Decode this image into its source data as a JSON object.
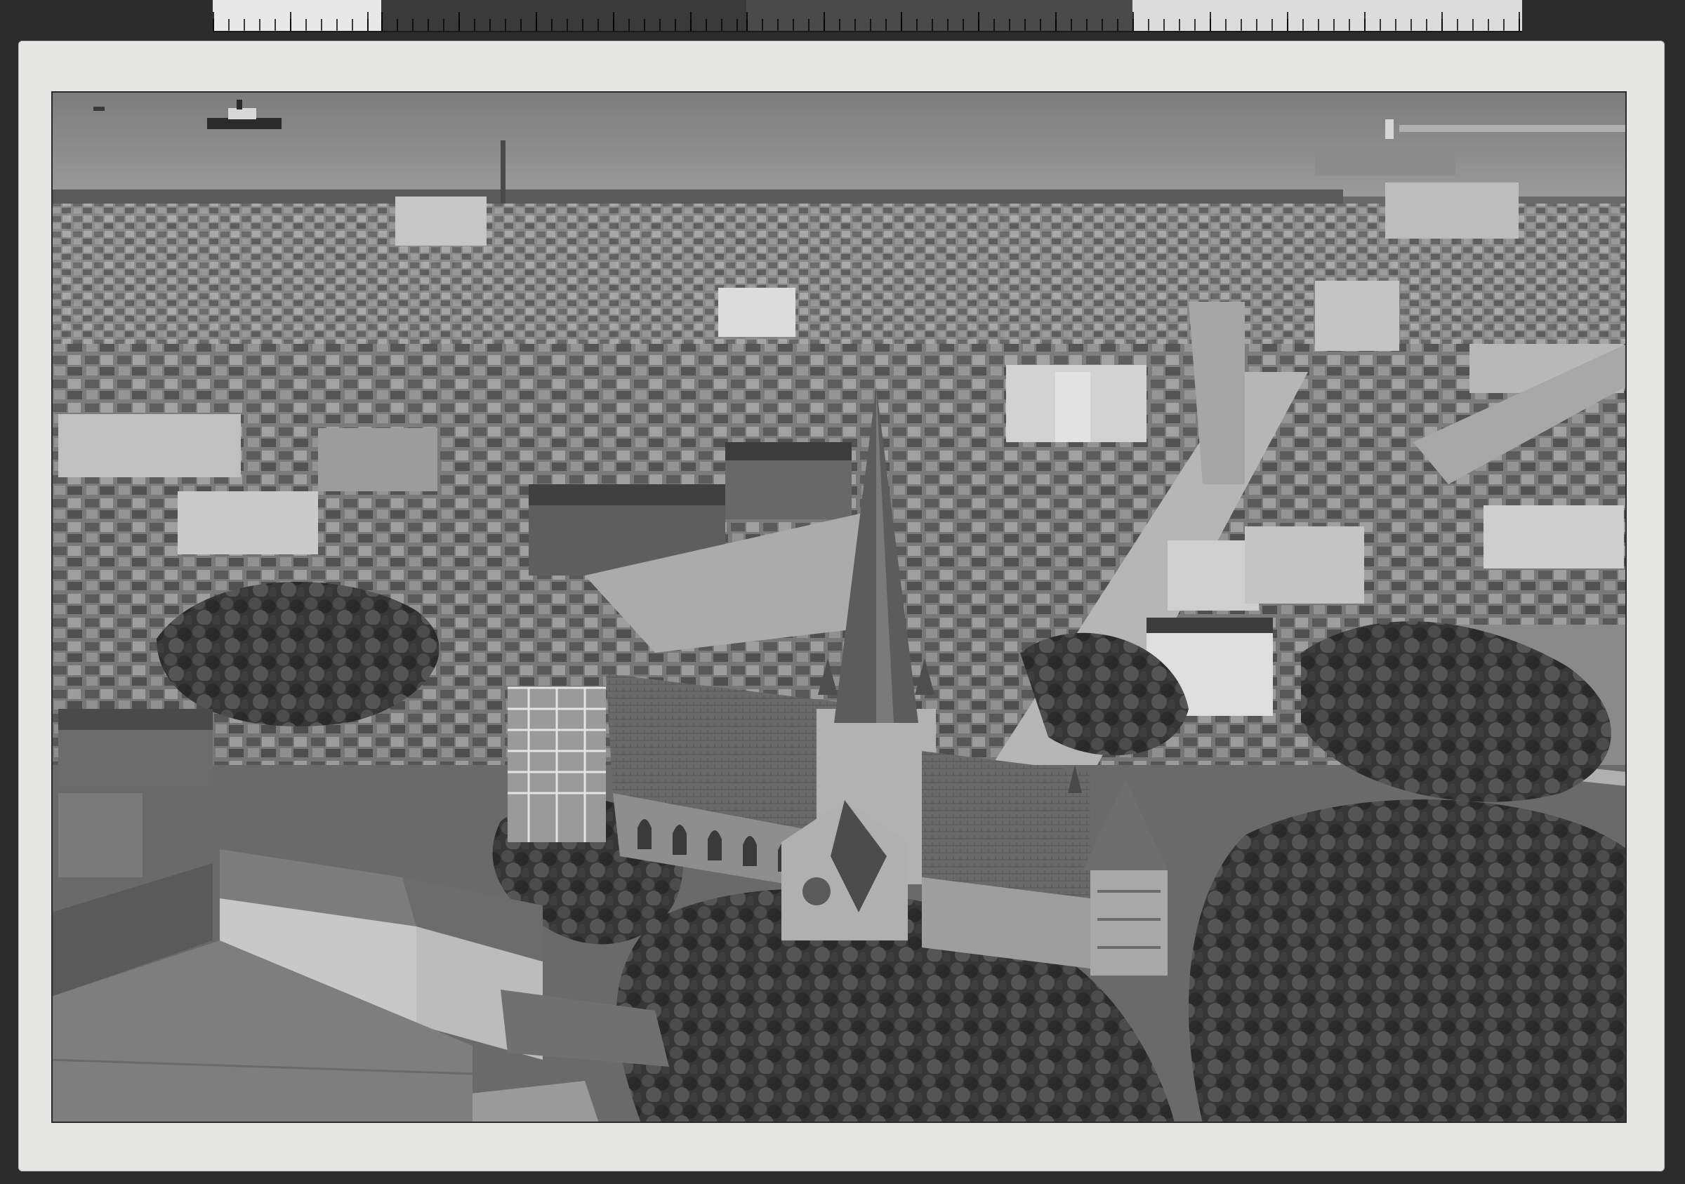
{
  "image": {
    "kind": "archival black-and-white aerial photograph mounted on card",
    "subject_icon": "aerial-city-cathedral-photo",
    "palette": {
      "background": "#2c2c2c",
      "card": "#e6e6e4",
      "sea": "#8e8e8e",
      "roofs_dark": "#3e3e3e",
      "roofs_light": "#b8b8b8",
      "trees": "#2f2f2f",
      "square": "#a9a9a9"
    }
  },
  "ruler": {
    "segments": [
      {
        "tone": "#e8e8e8"
      },
      {
        "tone": "#3a3a3a"
      },
      {
        "tone": "#9a9a9a"
      },
      {
        "tone": "#d4d4d4"
      }
    ]
  }
}
